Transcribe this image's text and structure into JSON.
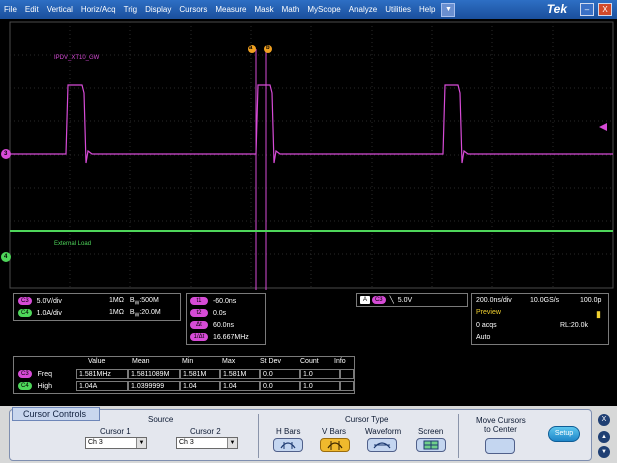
{
  "menu": {
    "items": [
      "File",
      "Edit",
      "Vertical",
      "Horiz/Acq",
      "Trig",
      "Display",
      "Cursors",
      "Measure",
      "Mask",
      "Math",
      "MyScope",
      "Analyze",
      "Utilities",
      "Help"
    ],
    "dropdown_glyph": "▼",
    "brand": "Tek",
    "minimize": "–",
    "close": "X"
  },
  "scope": {
    "trace1_label": "IPDV_XT10_GW",
    "trace2_label": "External Load",
    "ch3_marker": "3",
    "ch4_marker": "4",
    "cursor_a": "a",
    "cursor_b": "b",
    "trace1_color": "#d64bd6",
    "trace2_color": "#4ed65a"
  },
  "channels": {
    "ch3": {
      "badge": "C3",
      "scale": "5.0V/div",
      "coupling": "1MΩ",
      "bw_prefix": "B",
      "bw_sub": "W",
      "bw": ":500M"
    },
    "ch4": {
      "badge": "C4",
      "scale": "1.0A/div",
      "coupling": "1MΩ",
      "bw_prefix": "B",
      "bw_sub": "W",
      "bw": ":20.0M"
    }
  },
  "cursor_readout": {
    "t1_badge": "t1",
    "t1": "-60.0ns",
    "t2_badge": "t2",
    "t2": "0.0s",
    "dt_badge": "Δt",
    "dt": "60.0ns",
    "freq_badge": "1/Δt",
    "freq": "16.667MHz"
  },
  "trigger": {
    "source_badge": "A",
    "channel_badge": "C3",
    "slope": "╲",
    "level": "5.0V"
  },
  "horizontal": {
    "timebase": "200.0ns/div",
    "sample_rate": "10.0GS/s",
    "point_spacing": "100.0p",
    "mode": "Preview",
    "acqs": "0 acqs",
    "record_length": "RL:20.0k",
    "trigger_mode": "Auto"
  },
  "measurements": {
    "headers": [
      "Value",
      "Mean",
      "Min",
      "Max",
      "St Dev",
      "Count",
      "Info"
    ],
    "rows": [
      {
        "badge": "C3",
        "name": "Freq",
        "cells": [
          "1.581MHz",
          "1.5811089M",
          "1.581M",
          "1.581M",
          "0.0",
          "1.0",
          ""
        ]
      },
      {
        "badge": "C4",
        "name": "High",
        "cells": [
          "1.04A",
          "1.0399999",
          "1.04",
          "1.04",
          "0.0",
          "1.0",
          ""
        ]
      }
    ]
  },
  "controls": {
    "title": "Cursor Controls",
    "source_label": "Source",
    "cursor1_label": "Cursor 1",
    "cursor1_value": "Ch 3",
    "cursor2_label": "Cursor 2",
    "cursor2_value": "Ch 3",
    "cursor_type_label": "Cursor Type",
    "types": [
      "H Bars",
      "V Bars",
      "Waveform",
      "Screen"
    ],
    "active_type": "V Bars",
    "move_label_1": "Move Cursors",
    "move_label_2": "to Center",
    "setup": "Setup",
    "close_glyph": "X",
    "up_glyph": "▲",
    "down_glyph": "▼",
    "arrow_glyph": "▼"
  }
}
